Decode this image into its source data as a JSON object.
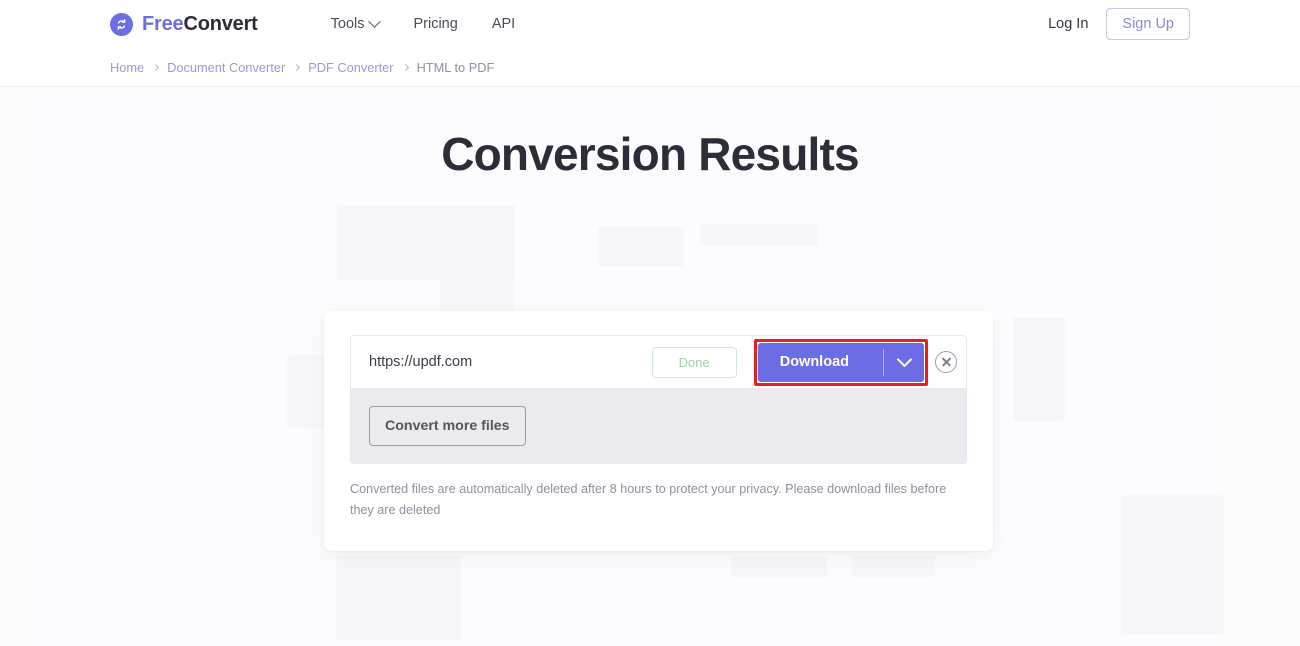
{
  "header": {
    "brand": {
      "icon": "sync-circle-icon",
      "text_primary": "Free",
      "text_secondary": "Convert"
    },
    "nav": [
      {
        "label": "Tools",
        "has_caret": true,
        "icon": "chevron-down-icon"
      },
      {
        "label": "Pricing",
        "has_caret": false
      },
      {
        "label": "API",
        "has_caret": false
      }
    ],
    "login_label": "Log In",
    "signup_label": "Sign Up"
  },
  "breadcrumb": {
    "items": [
      {
        "label": "Home",
        "current": false
      },
      {
        "label": "Document Converter",
        "current": false
      },
      {
        "label": "PDF Converter",
        "current": false
      },
      {
        "label": "HTML to PDF",
        "current": true
      }
    ]
  },
  "main": {
    "title": "Conversion Results",
    "file": {
      "name": "https://updf.com",
      "status_label": "Done",
      "download_label": "Download",
      "download_caret_icon": "chevron-down-icon",
      "remove_icon": "close-circle-icon"
    },
    "convert_more_label": "Convert more files",
    "privacy_note": "Converted files are automatically deleted after 8 hours to protect your privacy. Please download files before they are deleted"
  },
  "annotation": {
    "highlight_target": "download-button",
    "highlight_color": "#e81f1f"
  },
  "colors": {
    "brand_purple": "#6C6CE5",
    "done_green": "#9ad3a6",
    "page_background": "#fcfcfd",
    "text_dark": "#2b2d38",
    "text_muted": "#8e909c"
  }
}
